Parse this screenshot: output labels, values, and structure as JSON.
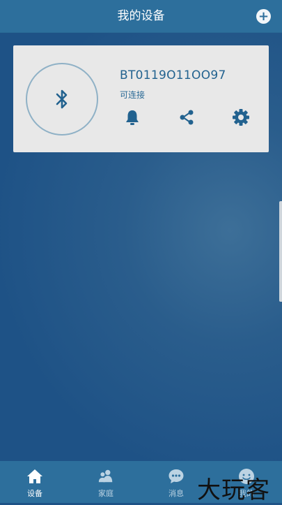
{
  "header": {
    "title": "我的设备",
    "add_icon": "plus-icon"
  },
  "device": {
    "name": "BT0119O11OO97",
    "status": "可连接",
    "icons": [
      "bluetooth-icon",
      "bell-icon",
      "share-icon",
      "gear-icon"
    ]
  },
  "tabs": [
    {
      "label": "设备",
      "icon": "home-icon",
      "active": true
    },
    {
      "label": "家庭",
      "icon": "family-icon",
      "active": false
    },
    {
      "label": "消息",
      "icon": "message-icon",
      "active": false
    },
    {
      "label": "我的",
      "icon": "profile-icon",
      "active": false
    }
  ],
  "watermark": "大玩客",
  "colors": {
    "accent": "#2d6f9c",
    "background": "#1e5286",
    "card": "#e8e8e8",
    "icon": "#22628f"
  }
}
